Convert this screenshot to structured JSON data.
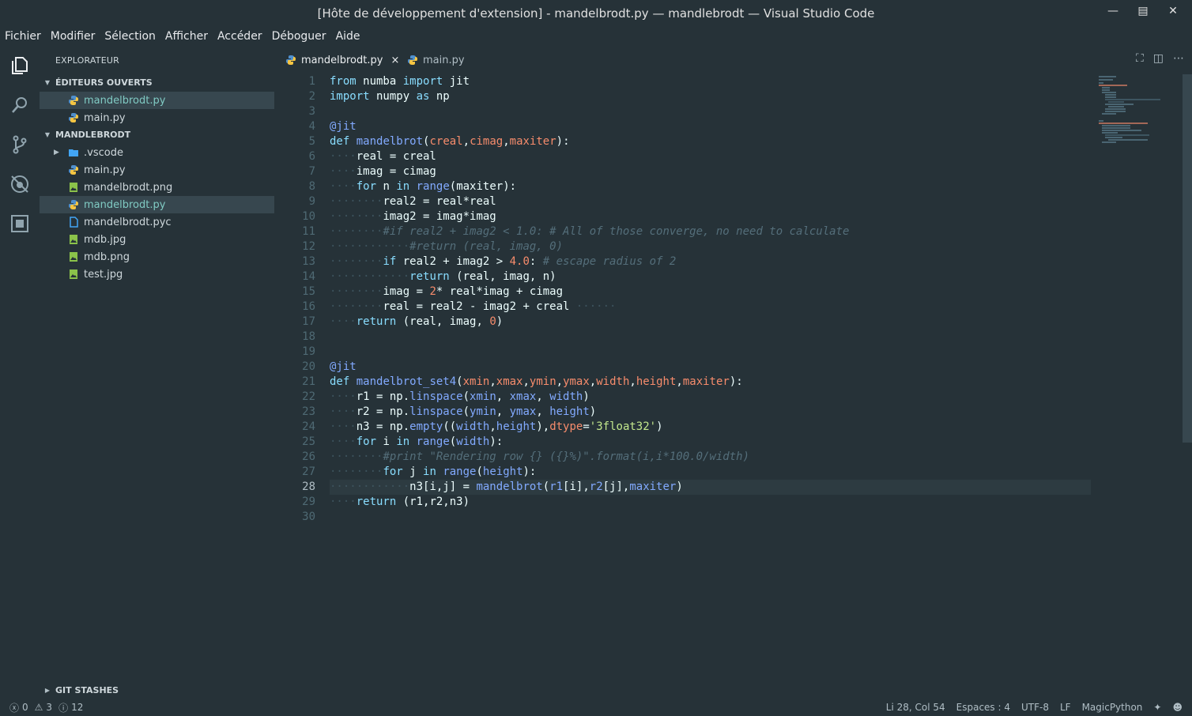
{
  "window": {
    "title": "[Hôte de développement d'extension] - mandelbrodt.py — mandlebrodt — Visual Studio Code"
  },
  "menu": [
    "Fichier",
    "Modifier",
    "Sélection",
    "Afficher",
    "Accéder",
    "Déboguer",
    "Aide"
  ],
  "sidebar": {
    "title": "EXPLORATEUR",
    "open_editors_header": "ÉDITEURS OUVERTS",
    "open_editors": [
      "mandelbrodt.py",
      "main.py"
    ],
    "project_header": "MANDLEBRODT",
    "files": [
      ".vscode",
      "main.py",
      "mandelbrodt.png",
      "mandelbrodt.py",
      "mandelbrodt.pyc",
      "mdb.jpg",
      "mdb.png",
      "test.jpg"
    ],
    "git_stashes": "GIT STASHES"
  },
  "tabs": [
    {
      "label": "mandelbrodt.py",
      "close": "×"
    },
    {
      "label": "main.py"
    }
  ],
  "editor": {
    "line_numbers": [
      "1",
      "2",
      "3",
      "4",
      "5",
      "6",
      "7",
      "8",
      "9",
      "10",
      "11",
      "12",
      "13",
      "14",
      "15",
      "16",
      "17",
      "18",
      "19",
      "20",
      "21",
      "22",
      "23",
      "24",
      "25",
      "26",
      "27",
      "28",
      "29",
      "30"
    ]
  },
  "status": {
    "errors": "0",
    "warnings": "3",
    "infos": "12",
    "position": "Li 28, Col 54",
    "indent": "Espaces : 4",
    "encoding": "UTF-8",
    "eol": "LF",
    "language": "MagicPython"
  },
  "colors": {
    "background": "#263238",
    "keyword": "#89ddff",
    "function": "#82aaff",
    "param": "#f78c6c",
    "string": "#c3e88d",
    "comment": "#546e7a"
  }
}
